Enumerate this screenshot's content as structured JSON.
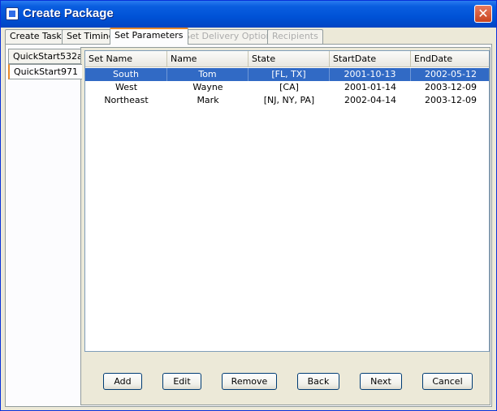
{
  "window": {
    "title": "Create Package"
  },
  "tabs": [
    {
      "label": "Create Task",
      "state": "normal"
    },
    {
      "label": "Set Timing",
      "state": "normal"
    },
    {
      "label": "Set Parameters",
      "state": "active"
    },
    {
      "label": "Set Delivery Options",
      "state": "disabled"
    },
    {
      "label": "Recipients",
      "state": "disabled"
    }
  ],
  "side_tabs": [
    {
      "label": "QuickStart532a",
      "state": "normal"
    },
    {
      "label": "QuickStart971",
      "state": "active"
    }
  ],
  "table": {
    "columns": [
      "Set Name",
      "Name",
      "State",
      "StartDate",
      "EndDate"
    ],
    "rows": [
      {
        "set_name": "South",
        "name": "Tom",
        "state": "[FL, TX]",
        "start": "2001-10-13",
        "end": "2002-05-12",
        "selected": true
      },
      {
        "set_name": "West",
        "name": "Wayne",
        "state": "[CA]",
        "start": "2001-01-14",
        "end": "2003-12-09",
        "selected": false
      },
      {
        "set_name": "Northeast",
        "name": "Mark",
        "state": "[NJ, NY, PA]",
        "start": "2002-04-14",
        "end": "2003-12-09",
        "selected": false
      }
    ]
  },
  "buttons": {
    "add": "Add",
    "edit": "Edit",
    "remove": "Remove",
    "back": "Back",
    "next": "Next",
    "cancel": "Cancel"
  },
  "colors": {
    "title_bar": "#0052d6",
    "selection": "#316ac5",
    "active_tab_accent": "#e68b2c"
  },
  "icons": {
    "title": "application-window-icon",
    "close": "close-icon"
  }
}
